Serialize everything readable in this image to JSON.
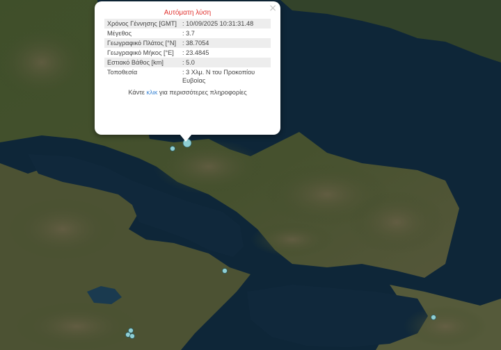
{
  "popup": {
    "title": "Αυτόματη λύση",
    "close": "×",
    "rows": [
      {
        "label": "Χρόνος Γέννησης [GMT]",
        "value": ": 10/09/2025 10:31:31.48"
      },
      {
        "label": "Μέγεθος",
        "value": ": 3.7"
      },
      {
        "label": "Γεωγραφικό Πλάτος [°N]",
        "value": ": 38.7054"
      },
      {
        "label": "Γεωγραφικό Μήκος [°E]",
        "value": ": 23.4845"
      },
      {
        "label": "Εστιακό Βάθος [km]",
        "value": ": 5.0"
      },
      {
        "label": "Τοποθεσία",
        "value": ": 3 Χλμ. Ν του Προκοπίου Ευβοίας"
      }
    ],
    "more_prefix": "Κάντε ",
    "more_link": "κλικ",
    "more_suffix": " για περισσότερες πληροφορίες"
  },
  "colors": {
    "sea": "#0e2638",
    "land": "#3e4d2a",
    "marker": "#8fcfd4",
    "popup_title": "#e0322e",
    "link": "#3b86d4"
  },
  "markers": [
    {
      "name": "selected-epicenter",
      "selected": true,
      "magnitude": 3.7
    },
    {
      "name": "event",
      "selected": false
    },
    {
      "name": "event",
      "selected": false
    },
    {
      "name": "event",
      "selected": false
    },
    {
      "name": "event",
      "selected": false
    },
    {
      "name": "event",
      "selected": false
    },
    {
      "name": "event",
      "selected": false
    }
  ]
}
